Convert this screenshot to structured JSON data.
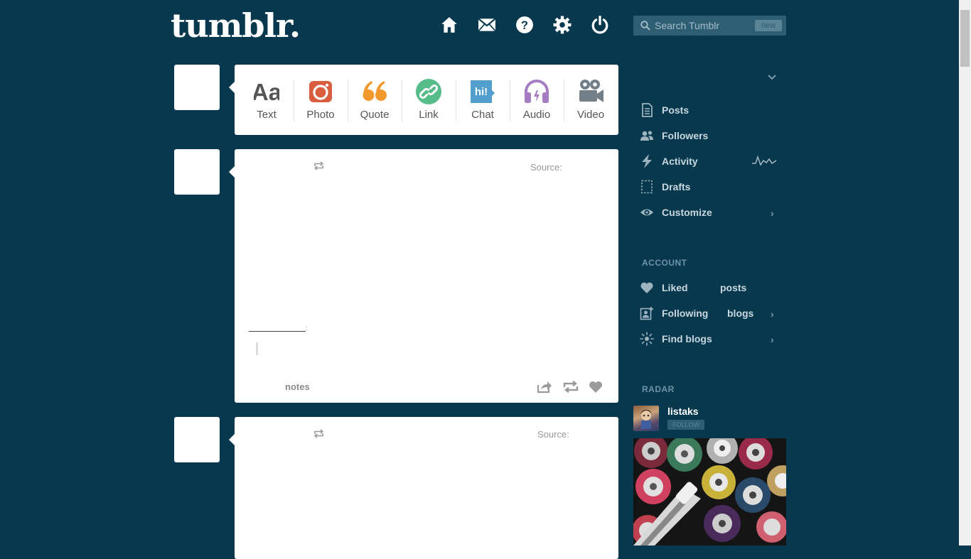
{
  "header": {
    "logo": "tumblr.",
    "search_placeholder": "Search Tumblr",
    "search_badge": "new"
  },
  "post_types": [
    {
      "label": "Text",
      "icon": "text-icon",
      "color": "#555555"
    },
    {
      "label": "Photo",
      "icon": "camera-icon",
      "color": "#d95e40"
    },
    {
      "label": "Quote",
      "icon": "quote-icon",
      "color": "#f2992e"
    },
    {
      "label": "Link",
      "icon": "link-icon",
      "color": "#56bc8a"
    },
    {
      "label": "Chat",
      "icon": "chat-icon",
      "color": "#529ecc"
    },
    {
      "label": "Audio",
      "icon": "headphones-icon",
      "color": "#a77dc2"
    },
    {
      "label": "Video",
      "icon": "video-camera-icon",
      "color": "#748089"
    }
  ],
  "posts": [
    {
      "source_label": "Source:",
      "notes_label": "notes"
    },
    {
      "source_label": "Source:"
    }
  ],
  "sidebar": {
    "blog_items": [
      {
        "label": "Posts",
        "icon": "posts-icon"
      },
      {
        "label": "Followers",
        "icon": "followers-icon"
      },
      {
        "label": "Activity",
        "icon": "lightning-icon"
      },
      {
        "label": "Drafts",
        "icon": "drafts-icon"
      },
      {
        "label": "Customize",
        "icon": "eye-icon"
      }
    ],
    "account_heading": "ACCOUNT",
    "account_items": [
      {
        "label": "Liked",
        "suffix": "posts",
        "icon": "heart-icon"
      },
      {
        "label": "Following",
        "suffix": "blogs",
        "icon": "following-icon"
      },
      {
        "label": "Find blogs",
        "suffix": "",
        "icon": "find-blogs-icon"
      }
    ],
    "radar_heading": "RADAR",
    "radar": {
      "name": "listaks",
      "follow_label": "FOLLOW"
    }
  },
  "colors": {
    "background": "#07384d",
    "sidebar_text": "#c9d8df",
    "search_bg": "#2d5e73"
  }
}
